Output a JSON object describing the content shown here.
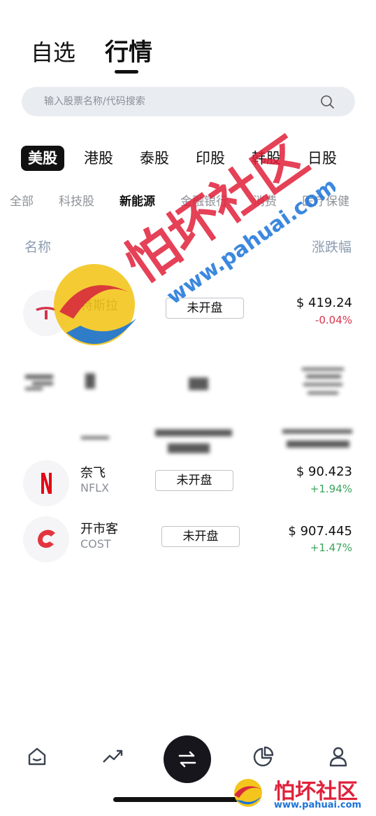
{
  "header": {
    "tab_watchlist": "自选",
    "tab_market": "行情"
  },
  "search": {
    "placeholder": "输入股票名称/代码搜索"
  },
  "markets": [
    "美股",
    "港股",
    "泰股",
    "印股",
    "韩股",
    "日股"
  ],
  "categories": [
    "全部",
    "科技股",
    "新能源",
    "金融银行",
    "消费",
    "医疗保健"
  ],
  "columns": {
    "name": "名称",
    "change": "涨跌幅"
  },
  "stocks": [
    {
      "name": "特斯拉",
      "ticker": "",
      "status": "未开盘",
      "price": "$ 419.24",
      "change": "-0.04%"
    },
    {
      "name": "奈飞",
      "ticker": "NFLX",
      "status": "未开盘",
      "price": "$ 90.423",
      "change": "+1.94%"
    },
    {
      "name": "开市客",
      "ticker": "COST",
      "status": "未开盘",
      "price": "$ 907.445",
      "change": "+1.47%"
    }
  ],
  "watermark": {
    "text": "怕坏社区",
    "url": "www.pahuai.com"
  },
  "colors": {
    "down": "#d6344a",
    "up": "#3ba55d",
    "accent": "#16161c"
  }
}
